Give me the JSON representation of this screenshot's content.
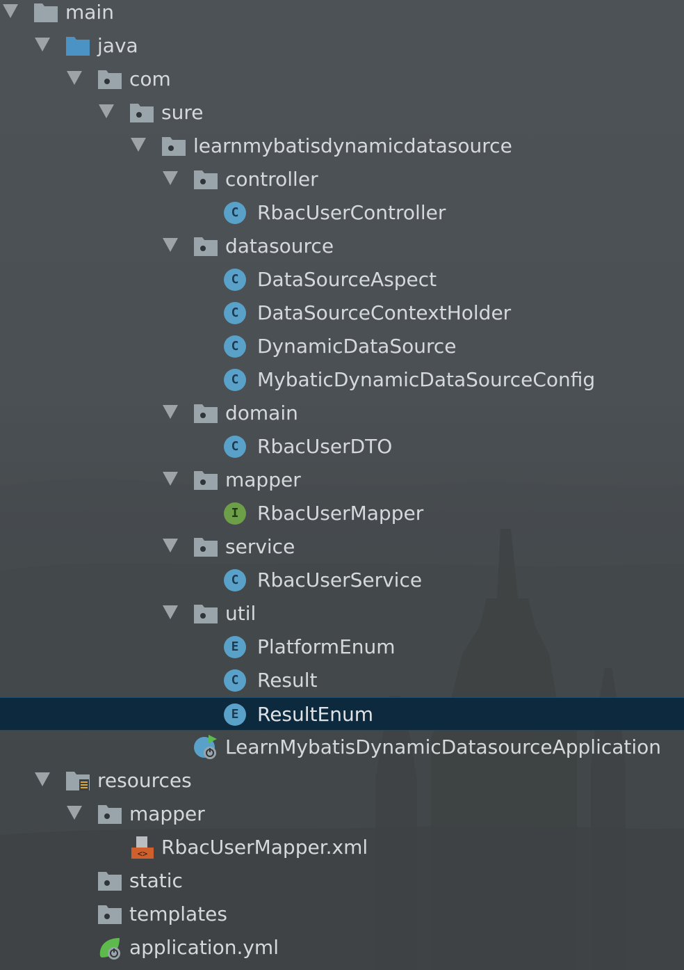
{
  "tree": [
    {
      "label": "main",
      "kind": "folder-plain",
      "depth": 0,
      "expanded": true
    },
    {
      "label": "java",
      "kind": "folder-source",
      "depth": 1,
      "expanded": true
    },
    {
      "label": "com",
      "kind": "package",
      "depth": 2,
      "expanded": true
    },
    {
      "label": "sure",
      "kind": "package",
      "depth": 3,
      "expanded": true
    },
    {
      "label": "learnmybatisdynamicdatasource",
      "kind": "package",
      "depth": 4,
      "expanded": true
    },
    {
      "label": "controller",
      "kind": "package",
      "depth": 5,
      "expanded": true
    },
    {
      "label": "RbacUserController",
      "kind": "class",
      "badge": "C",
      "depth": 6
    },
    {
      "label": "datasource",
      "kind": "package",
      "depth": 5,
      "expanded": true
    },
    {
      "label": "DataSourceAspect",
      "kind": "class",
      "badge": "C",
      "depth": 6
    },
    {
      "label": "DataSourceContextHolder",
      "kind": "class",
      "badge": "C",
      "depth": 6
    },
    {
      "label": "DynamicDataSource",
      "kind": "class",
      "badge": "C",
      "depth": 6
    },
    {
      "label": "MybaticDynamicDataSourceConfig",
      "kind": "class",
      "badge": "C",
      "depth": 6
    },
    {
      "label": "domain",
      "kind": "package",
      "depth": 5,
      "expanded": true
    },
    {
      "label": "RbacUserDTO",
      "kind": "class",
      "badge": "C",
      "depth": 6
    },
    {
      "label": "mapper",
      "kind": "package",
      "depth": 5,
      "expanded": true
    },
    {
      "label": "RbacUserMapper",
      "kind": "interface",
      "badge": "I",
      "depth": 6
    },
    {
      "label": "service",
      "kind": "package",
      "depth": 5,
      "expanded": true
    },
    {
      "label": "RbacUserService",
      "kind": "class",
      "badge": "C",
      "depth": 6
    },
    {
      "label": "util",
      "kind": "package",
      "depth": 5,
      "expanded": true
    },
    {
      "label": "PlatformEnum",
      "kind": "enum",
      "badge": "E",
      "depth": 6
    },
    {
      "label": "Result",
      "kind": "class",
      "badge": "C",
      "depth": 6
    },
    {
      "label": "ResultEnum",
      "kind": "enum",
      "badge": "E",
      "depth": 6,
      "selected": true
    },
    {
      "label": "LearnMybatisDynamicDatasourceApplication",
      "kind": "spring-app",
      "depth": 5
    },
    {
      "label": "resources",
      "kind": "folder-resources",
      "depth": 1,
      "expanded": true
    },
    {
      "label": "mapper",
      "kind": "package",
      "depth": 2,
      "expanded": true
    },
    {
      "label": "RbacUserMapper.xml",
      "kind": "xml-file",
      "depth": 3
    },
    {
      "label": "static",
      "kind": "package",
      "depth": 2
    },
    {
      "label": "templates",
      "kind": "package",
      "depth": 2
    },
    {
      "label": "application.yml",
      "kind": "spring-config",
      "depth": 2
    }
  ],
  "colors": {
    "text": "#d6d9db",
    "selection": "#0d293e",
    "class_badge": "#5aa1c9",
    "interface_badge": "#6c9f48",
    "folder": "#9aa4ab",
    "source_folder": "#4b93c4"
  }
}
